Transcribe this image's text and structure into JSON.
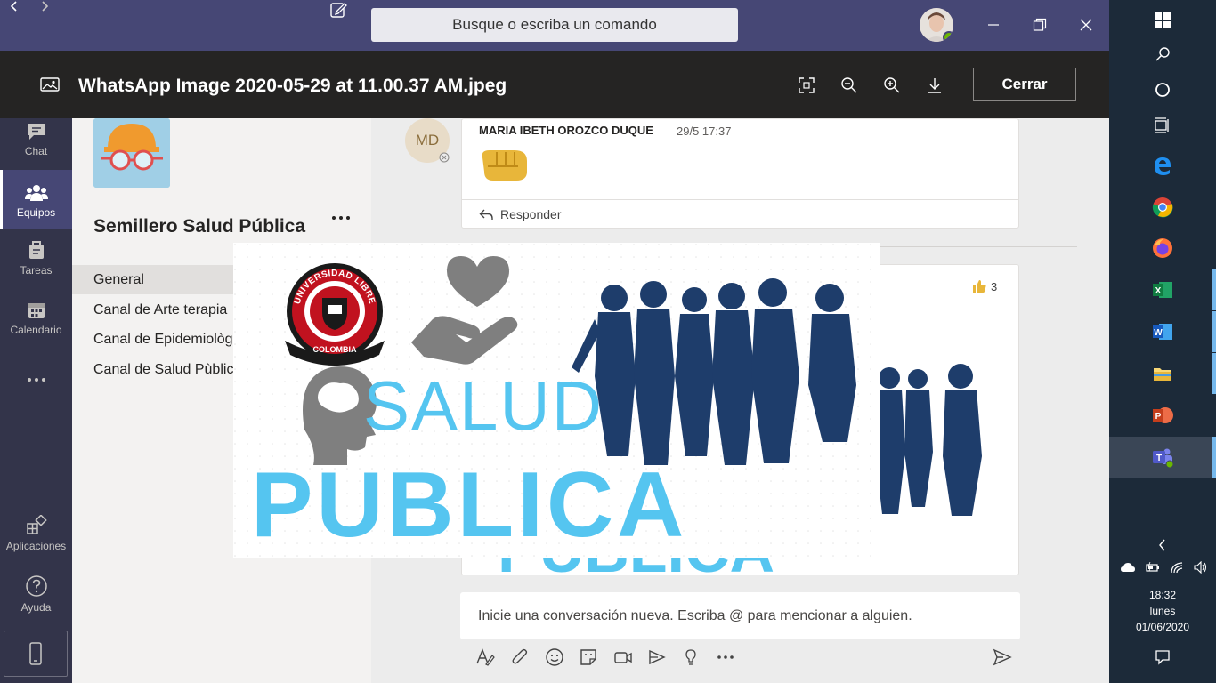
{
  "titlebar": {
    "search_placeholder": "Busque o escriba un comando"
  },
  "viewer": {
    "file_title": "WhatsApp Image 2020-05-29 at 11.00.37 AM.jpeg",
    "close_label": "Cerrar"
  },
  "rail": {
    "items": [
      {
        "label": "Chat",
        "icon": "chat-icon"
      },
      {
        "label": "Equipos",
        "icon": "teams-icon",
        "active": true
      },
      {
        "label": "Tareas",
        "icon": "assignments-icon"
      },
      {
        "label": "Calendario",
        "icon": "calendar-icon"
      },
      {
        "label": "Aplicaciones",
        "icon": "apps-icon"
      },
      {
        "label": "Ayuda",
        "icon": "help-icon"
      }
    ]
  },
  "team": {
    "name": "Semillero Salud Pública",
    "channels": [
      "General",
      "Canal de Arte terapia",
      "Canal de Epidemiològ",
      "Canal de Salud Pùblic"
    ]
  },
  "conversation": {
    "avatar_initials": "MD",
    "author": "MARIA IBETH OROZCO DUQUE",
    "time": "29/5 17:37",
    "reply_label": "Responder",
    "likes_count": "3",
    "compose_placeholder": "Inicie una conversación nueva. Escriba @ para mencionar a alguien."
  },
  "overlay_image": {
    "logo_text_top": "UNIVERSIDAD LIBRE",
    "logo_text_bottom": "COLOMBIA",
    "word1": "SALUD",
    "word2": "PUBLICA",
    "colors": {
      "light_blue": "#55c5f0",
      "navy": "#1e3d6b",
      "grey": "#7f7f7f",
      "red": "#c1121f"
    }
  },
  "taskbar": {
    "time": "18:32",
    "day": "lunes",
    "date": "01/06/2020"
  },
  "colors": {
    "titlebar": "#464775",
    "rail": "#33344a",
    "viewer_header": "#252423",
    "taskbar": "#1c2a39"
  }
}
